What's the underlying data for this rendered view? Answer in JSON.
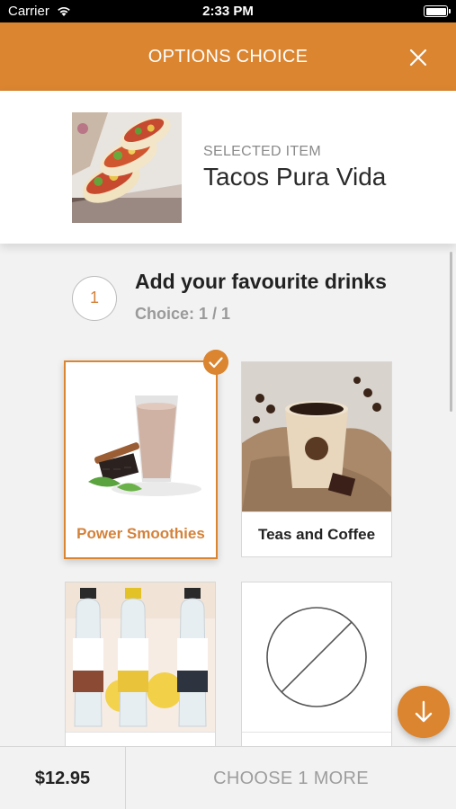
{
  "status_bar": {
    "carrier": "Carrier",
    "time": "2:33 PM"
  },
  "header": {
    "title": "OPTIONS CHOICE",
    "close_icon": "close-icon"
  },
  "selected_item": {
    "caption": "SELECTED ITEM",
    "name": "Tacos Pura Vida"
  },
  "step": {
    "number": "1",
    "title": "Add your favourite drinks",
    "choice": "Choice: 1 / 1"
  },
  "options": [
    {
      "label": "Power Smoothies",
      "selected": true
    },
    {
      "label": "Teas and Coffee",
      "selected": false
    },
    {
      "label": "",
      "selected": false
    },
    {
      "label": "",
      "selected": false,
      "icon": "none-icon"
    }
  ],
  "footer": {
    "price": "$12.95",
    "action": "CHOOSE 1 MORE"
  },
  "colors": {
    "accent": "#db8530",
    "text": "#222222",
    "muted": "#9a9a9a"
  }
}
